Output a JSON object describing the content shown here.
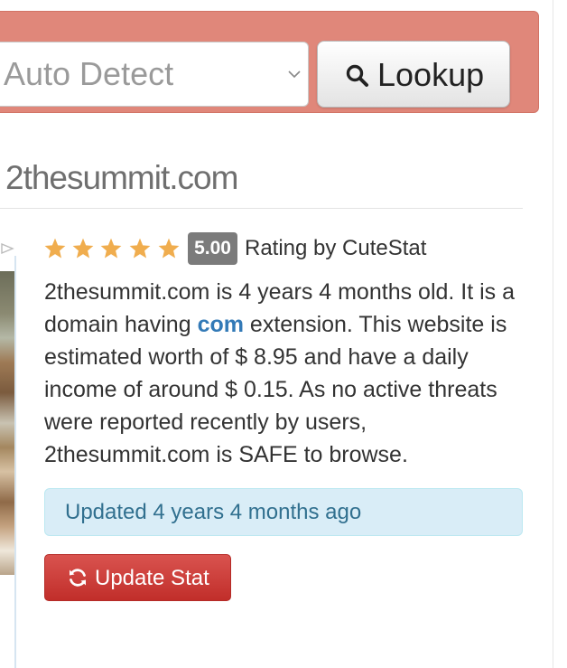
{
  "search": {
    "selected_option": "Auto Detect",
    "lookup_label": "Lookup",
    "icons": {
      "select": "chevron-down-icon",
      "lookup": "search-icon"
    }
  },
  "site": {
    "domain": "2thesummit.com"
  },
  "rating": {
    "stars": 5,
    "max_stars": 5,
    "score": "5.00",
    "label": "Rating by CuteStat"
  },
  "description": {
    "part1": "2thesummit.com is 4 years 4 months old. It is a domain having ",
    "extension": "com",
    "part2": " extension. This website is estimated worth of $ 8.95 and have a daily income of around $ 0.15. As no active threats were reported recently by users, 2thesummit.com is SAFE to browse."
  },
  "updated": {
    "text": "Updated 4 years 4 months ago"
  },
  "update_button": {
    "label": "Update Stat",
    "icon": "refresh-icon"
  },
  "colors": {
    "search_bar": "#e0877a",
    "star": "#f0ad4e",
    "badge": "#7b7b7b",
    "link": "#337ab7",
    "alert_bg": "#d9edf7",
    "alert_text": "#31708f",
    "danger": "#d9534f"
  }
}
